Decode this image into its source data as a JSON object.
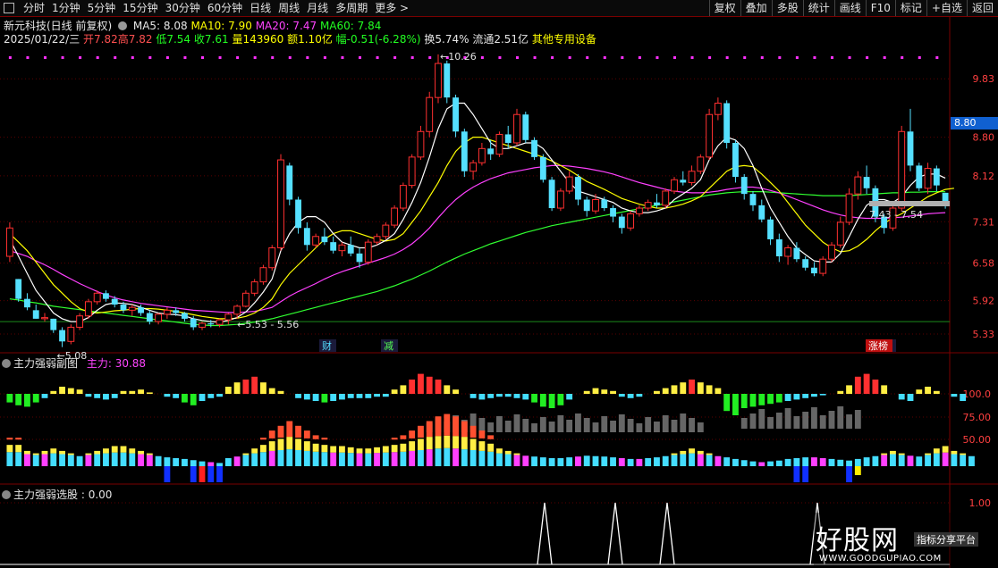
{
  "toolbar": {
    "period_tabs": [
      "分时",
      "1分钟",
      "5分钟",
      "15分钟",
      "30分钟",
      "60分钟",
      "日线",
      "周线",
      "月线",
      "多周期",
      "更多 >"
    ],
    "right_buttons": [
      "复权",
      "叠加",
      "多股",
      "统计",
      "画线",
      "F10",
      "标记",
      "+自选",
      "返回"
    ]
  },
  "stock": {
    "title": "新元科技(日线 前复权)",
    "ma5": "MA5: 8.08",
    "ma10": "MA10: 7.90",
    "ma20": "MA20: 7.47",
    "ma60": "MA60: 7.84",
    "date": "2025/01/22/三",
    "open": "开7.82",
    "high": "高7.82",
    "low": "低7.54",
    "close": "收7.61",
    "volume": "量143960",
    "amount": "额1.10亿",
    "change": "幅-0.51(-6.28%)",
    "turnover": "换5.74%",
    "float": "流通2.51亿",
    "sector": "其他专用设备"
  },
  "price_axis": [
    "9.83",
    "8.80",
    "8.12",
    "7.31",
    "6.58",
    "5.92",
    "5.33"
  ],
  "current_price": "8.80",
  "annotations": {
    "high": "10.26",
    "low": "5.08",
    "range_left": "5.53 - 5.56",
    "range_right": "7.43 - 7.54",
    "badge_cai": "财",
    "badge_jian": "减",
    "badge_zhangbang": "涨榜"
  },
  "indicator1": {
    "name": "主力强弱副图",
    "label": "主力: 30.88",
    "axis": [
      "100.0",
      "75.00",
      "50.00"
    ]
  },
  "indicator2": {
    "name": "主力强弱选股",
    "label": ": 0.00",
    "axis": [
      "1.00"
    ]
  },
  "watermark": {
    "logo": "好股网",
    "sub": "指标分享平台",
    "url": "WWW.GOODGUPIAO.COM"
  },
  "colors": {
    "up": "#ff3030",
    "down": "#55e0ff",
    "ma5": "#ffffff",
    "ma10": "#ffff00",
    "ma20": "#ff40ff",
    "ma60": "#30ff30",
    "background": "#000000"
  },
  "chart_data": {
    "type": "candlestick",
    "ohlc": [
      [
        6.7,
        7.3,
        6.6,
        7.2
      ],
      [
        6.3,
        6.3,
        5.9,
        5.95
      ],
      [
        5.95,
        6.05,
        5.75,
        5.8
      ],
      [
        5.75,
        5.85,
        5.6,
        5.6
      ],
      [
        5.6,
        5.7,
        5.55,
        5.62
      ],
      [
        5.6,
        5.6,
        5.35,
        5.4
      ],
      [
        5.4,
        5.45,
        5.1,
        5.2
      ],
      [
        5.2,
        5.5,
        5.15,
        5.45
      ],
      [
        5.45,
        5.7,
        5.4,
        5.65
      ],
      [
        5.65,
        5.95,
        5.6,
        5.9
      ],
      [
        5.9,
        6.1,
        5.85,
        6.05
      ],
      [
        6.05,
        6.1,
        5.9,
        5.95
      ],
      [
        5.95,
        6.0,
        5.8,
        5.85
      ],
      [
        5.85,
        5.9,
        5.7,
        5.75
      ],
      [
        5.75,
        5.85,
        5.65,
        5.8
      ],
      [
        5.8,
        5.85,
        5.65,
        5.7
      ],
      [
        5.7,
        5.75,
        5.5,
        5.55
      ],
      [
        5.55,
        5.7,
        5.5,
        5.68
      ],
      [
        5.68,
        5.8,
        5.6,
        5.75
      ],
      [
        5.75,
        5.8,
        5.65,
        5.7
      ],
      [
        5.7,
        5.72,
        5.55,
        5.6
      ],
      [
        5.6,
        5.65,
        5.4,
        5.45
      ],
      [
        5.45,
        5.55,
        5.4,
        5.52
      ],
      [
        5.52,
        5.58,
        5.45,
        5.5
      ],
      [
        5.5,
        5.6,
        5.45,
        5.58
      ],
      [
        5.58,
        5.7,
        5.5,
        5.68
      ],
      [
        5.68,
        5.85,
        5.6,
        5.82
      ],
      [
        5.82,
        6.1,
        5.8,
        6.05
      ],
      [
        6.05,
        6.3,
        6.0,
        6.25
      ],
      [
        6.25,
        6.55,
        6.2,
        6.5
      ],
      [
        6.5,
        6.9,
        6.45,
        6.85
      ],
      [
        6.85,
        8.5,
        6.8,
        8.4
      ],
      [
        8.3,
        8.35,
        7.6,
        7.7
      ],
      [
        7.7,
        7.75,
        7.1,
        7.2
      ],
      [
        7.2,
        7.3,
        6.8,
        6.9
      ],
      [
        6.9,
        7.1,
        6.85,
        7.05
      ],
      [
        7.05,
        7.2,
        6.9,
        6.95
      ],
      [
        6.95,
        7.05,
        6.75,
        6.8
      ],
      [
        6.8,
        6.95,
        6.7,
        6.9
      ],
      [
        6.9,
        7.05,
        6.7,
        6.75
      ],
      [
        6.75,
        6.85,
        6.5,
        6.6
      ],
      [
        6.6,
        7.0,
        6.55,
        6.95
      ],
      [
        6.95,
        7.1,
        6.9,
        7.05
      ],
      [
        7.05,
        7.3,
        7.0,
        7.25
      ],
      [
        7.25,
        7.6,
        7.2,
        7.55
      ],
      [
        7.55,
        8.0,
        7.5,
        7.95
      ],
      [
        7.95,
        8.5,
        7.9,
        8.45
      ],
      [
        8.45,
        9.0,
        8.4,
        8.9
      ],
      [
        8.9,
        9.6,
        8.8,
        9.5
      ],
      [
        9.5,
        10.26,
        9.4,
        10.1
      ],
      [
        10.1,
        10.15,
        9.4,
        9.5
      ],
      [
        9.5,
        9.55,
        8.8,
        8.9
      ],
      [
        8.9,
        8.95,
        8.1,
        8.2
      ],
      [
        8.2,
        8.4,
        8.05,
        8.35
      ],
      [
        8.35,
        8.7,
        8.3,
        8.6
      ],
      [
        8.6,
        8.75,
        8.4,
        8.5
      ],
      [
        8.5,
        8.9,
        8.45,
        8.85
      ],
      [
        8.85,
        9.0,
        8.6,
        8.7
      ],
      [
        8.7,
        9.3,
        8.65,
        9.2
      ],
      [
        9.2,
        9.25,
        8.7,
        8.75
      ],
      [
        8.75,
        8.8,
        8.4,
        8.45
      ],
      [
        8.45,
        8.5,
        8.0,
        8.05
      ],
      [
        8.05,
        8.1,
        7.5,
        7.55
      ],
      [
        7.55,
        7.9,
        7.5,
        7.85
      ],
      [
        7.85,
        8.2,
        7.8,
        8.1
      ],
      [
        8.1,
        8.15,
        7.6,
        7.7
      ],
      [
        7.7,
        7.75,
        7.4,
        7.5
      ],
      [
        7.5,
        7.8,
        7.45,
        7.7
      ],
      [
        7.7,
        7.75,
        7.5,
        7.55
      ],
      [
        7.55,
        7.6,
        7.3,
        7.4
      ],
      [
        7.4,
        7.45,
        7.1,
        7.2
      ],
      [
        7.2,
        7.5,
        7.15,
        7.45
      ],
      [
        7.45,
        7.6,
        7.4,
        7.55
      ],
      [
        7.55,
        7.7,
        7.5,
        7.65
      ],
      [
        7.65,
        7.8,
        7.55,
        7.6
      ],
      [
        7.6,
        7.9,
        7.55,
        7.85
      ],
      [
        7.85,
        8.1,
        7.8,
        8.05
      ],
      [
        8.05,
        8.2,
        7.95,
        8.0
      ],
      [
        8.0,
        8.3,
        7.95,
        8.2
      ],
      [
        8.2,
        8.5,
        8.15,
        8.45
      ],
      [
        8.45,
        9.3,
        8.4,
        9.2
      ],
      [
        9.2,
        9.5,
        9.1,
        9.4
      ],
      [
        9.4,
        9.45,
        8.6,
        8.7
      ],
      [
        8.7,
        8.75,
        8.0,
        8.1
      ],
      [
        8.1,
        8.15,
        7.7,
        7.8
      ],
      [
        7.8,
        7.85,
        7.5,
        7.6
      ],
      [
        7.6,
        7.7,
        7.3,
        7.35
      ],
      [
        7.35,
        7.4,
        6.9,
        7.0
      ],
      [
        7.0,
        7.1,
        6.6,
        6.7
      ],
      [
        6.7,
        6.9,
        6.55,
        6.85
      ],
      [
        6.85,
        6.95,
        6.6,
        6.65
      ],
      [
        6.65,
        6.7,
        6.45,
        6.5
      ],
      [
        6.5,
        6.6,
        6.35,
        6.4
      ],
      [
        6.4,
        6.7,
        6.35,
        6.65
      ],
      [
        6.65,
        6.95,
        6.6,
        6.9
      ],
      [
        6.9,
        7.4,
        6.85,
        7.3
      ],
      [
        7.3,
        7.9,
        7.25,
        7.8
      ],
      [
        7.8,
        8.2,
        7.7,
        8.1
      ],
      [
        8.1,
        8.3,
        7.8,
        7.9
      ],
      [
        7.9,
        7.95,
        7.3,
        7.4
      ],
      [
        7.4,
        7.45,
        7.1,
        7.2
      ],
      [
        7.2,
        7.6,
        7.15,
        7.55
      ],
      [
        7.55,
        9.0,
        7.5,
        8.9
      ],
      [
        8.9,
        9.3,
        8.2,
        8.3
      ],
      [
        8.3,
        8.35,
        7.85,
        7.9
      ],
      [
        7.9,
        8.35,
        7.8,
        8.25
      ],
      [
        8.25,
        8.3,
        7.85,
        7.95
      ],
      [
        7.82,
        7.82,
        7.54,
        7.61
      ]
    ],
    "ma5": [
      7.0,
      6.7,
      6.4,
      6.1,
      5.9,
      5.7,
      5.6,
      5.55,
      5.55,
      5.62,
      5.75,
      5.85,
      5.88,
      5.87,
      5.85,
      5.8,
      5.75,
      5.7,
      5.68,
      5.67,
      5.65,
      5.6,
      5.57,
      5.55,
      5.54,
      5.57,
      5.62,
      5.72,
      5.88,
      6.07,
      6.3,
      6.8,
      7.1,
      7.3,
      7.4,
      7.4,
      7.3,
      7.1,
      6.95,
      6.9,
      6.85,
      6.85,
      6.9,
      6.98,
      7.1,
      7.35,
      7.65,
      8.0,
      8.45,
      8.95,
      9.3,
      9.4,
      9.4,
      9.2,
      8.95,
      8.7,
      8.6,
      8.6,
      8.65,
      8.7,
      8.7,
      8.6,
      8.4,
      8.2,
      8.0,
      7.85,
      7.8,
      7.75,
      7.7,
      7.65,
      7.55,
      7.5,
      7.47,
      7.47,
      7.5,
      7.55,
      7.7,
      7.8,
      7.9,
      8.05,
      8.4,
      8.65,
      8.8,
      8.75,
      8.6,
      8.3,
      7.9,
      7.55,
      7.3,
      7.05,
      6.85,
      6.73,
      6.62,
      6.6,
      6.6,
      6.75,
      7.05,
      7.35,
      7.6,
      7.7,
      7.7,
      7.65,
      7.75,
      7.95,
      8.1,
      8.15,
      8.15,
      8.08
    ],
    "ma10": [
      7.1,
      6.95,
      6.8,
      6.6,
      6.4,
      6.2,
      6.05,
      5.9,
      5.78,
      5.72,
      5.7,
      5.72,
      5.74,
      5.75,
      5.77,
      5.78,
      5.78,
      5.77,
      5.75,
      5.73,
      5.7,
      5.67,
      5.64,
      5.62,
      5.6,
      5.6,
      5.61,
      5.64,
      5.7,
      5.8,
      5.95,
      6.2,
      6.4,
      6.55,
      6.7,
      6.85,
      7.0,
      7.1,
      7.15,
      7.15,
      7.1,
      7.05,
      7.0,
      6.97,
      7.0,
      7.1,
      7.3,
      7.5,
      7.75,
      8.0,
      8.3,
      8.55,
      8.7,
      8.8,
      8.8,
      8.75,
      8.7,
      8.65,
      8.6,
      8.55,
      8.5,
      8.45,
      8.38,
      8.3,
      8.22,
      8.12,
      8.02,
      7.95,
      7.88,
      7.8,
      7.72,
      7.67,
      7.62,
      7.58,
      7.55,
      7.55,
      7.58,
      7.62,
      7.68,
      7.75,
      7.9,
      8.05,
      8.2,
      8.28,
      8.3,
      8.28,
      8.15,
      8.0,
      7.85,
      7.65,
      7.45,
      7.25,
      7.1,
      6.95,
      6.85,
      6.78,
      6.8,
      6.88,
      7.0,
      7.15,
      7.28,
      7.38,
      7.45,
      7.55,
      7.65,
      7.75,
      7.82,
      7.88,
      7.9
    ],
    "ma20": [
      6.8,
      6.75,
      6.7,
      6.62,
      6.55,
      6.47,
      6.38,
      6.3,
      6.22,
      6.15,
      6.08,
      6.02,
      5.97,
      5.93,
      5.9,
      5.87,
      5.85,
      5.83,
      5.81,
      5.79,
      5.77,
      5.75,
      5.74,
      5.73,
      5.72,
      5.71,
      5.71,
      5.72,
      5.73,
      5.76,
      5.8,
      5.9,
      6.0,
      6.08,
      6.15,
      6.22,
      6.3,
      6.37,
      6.43,
      6.48,
      6.53,
      6.58,
      6.63,
      6.68,
      6.74,
      6.82,
      6.92,
      7.05,
      7.2,
      7.38,
      7.55,
      7.7,
      7.82,
      7.92,
      8.0,
      8.07,
      8.12,
      8.17,
      8.2,
      8.23,
      8.26,
      8.28,
      8.3,
      8.3,
      8.29,
      8.27,
      8.25,
      8.22,
      8.19,
      8.15,
      8.1,
      8.05,
      8.0,
      7.96,
      7.92,
      7.88,
      7.85,
      7.83,
      7.82,
      7.82,
      7.83,
      7.85,
      7.88,
      7.9,
      7.92,
      7.92,
      7.9,
      7.86,
      7.82,
      7.76,
      7.7,
      7.64,
      7.58,
      7.52,
      7.47,
      7.43,
      7.4,
      7.38,
      7.37,
      7.37,
      7.37,
      7.38,
      7.39,
      7.41,
      7.43,
      7.45,
      7.46,
      7.47
    ],
    "ma60": [
      5.95,
      5.93,
      5.9,
      5.88,
      5.85,
      5.82,
      5.8,
      5.78,
      5.76,
      5.74,
      5.72,
      5.7,
      5.68,
      5.66,
      5.64,
      5.62,
      5.6,
      5.58,
      5.56,
      5.54,
      5.52,
      5.5,
      5.49,
      5.48,
      5.48,
      5.49,
      5.5,
      5.52,
      5.54,
      5.57,
      5.6,
      5.64,
      5.68,
      5.72,
      5.76,
      5.8,
      5.84,
      5.88,
      5.92,
      5.96,
      6.0,
      6.04,
      6.08,
      6.13,
      6.18,
      6.24,
      6.3,
      6.37,
      6.44,
      6.52,
      6.6,
      6.67,
      6.74,
      6.8,
      6.86,
      6.92,
      6.97,
      7.02,
      7.07,
      7.12,
      7.16,
      7.2,
      7.24,
      7.27,
      7.3,
      7.33,
      7.36,
      7.39,
      7.42,
      7.45,
      7.48,
      7.51,
      7.54,
      7.57,
      7.6,
      7.63,
      7.66,
      7.69,
      7.72,
      7.75,
      7.78,
      7.8,
      7.82,
      7.83,
      7.84,
      7.84,
      7.84,
      7.83,
      7.82,
      7.81,
      7.8,
      7.79,
      7.78,
      7.77,
      7.77,
      7.77,
      7.77,
      7.78,
      7.79,
      7.8,
      7.81,
      7.82,
      7.82,
      7.83,
      7.83,
      7.84,
      7.84,
      7.84
    ],
    "ylim": [
      5.0,
      10.4
    ],
    "ind1_top": [
      -6,
      -8,
      -9,
      -6,
      -3,
      2,
      5,
      4,
      3,
      -2,
      -3,
      -4,
      -3,
      2,
      2,
      3,
      1,
      0,
      -2,
      -3,
      -6,
      -8,
      -5,
      -3,
      -2,
      5,
      8,
      10,
      12,
      8,
      4,
      2,
      0,
      -3,
      -4,
      -5,
      -6,
      -5,
      -4,
      -3,
      -3,
      -3,
      -2,
      -2,
      3,
      6,
      10,
      14,
      12,
      10,
      6,
      3,
      0,
      -3,
      -4,
      -3,
      -2,
      -2,
      -3,
      -4,
      -6,
      -9,
      -10,
      -8,
      -4,
      0,
      2,
      4,
      3,
      2,
      -2,
      -3,
      -2,
      0,
      2,
      4,
      6,
      8,
      10,
      8,
      6,
      4,
      -12,
      -15,
      -10,
      -9,
      -8,
      -7,
      -6,
      -5,
      -4,
      -3,
      -2,
      -1,
      0,
      2,
      6,
      12,
      14,
      10,
      6,
      0,
      -4,
      -5,
      3,
      5,
      2,
      0,
      -2,
      -5
    ],
    "ind1_gray": [
      0,
      0,
      0,
      0,
      0,
      0,
      0,
      0,
      0,
      0,
      0,
      0,
      0,
      0,
      0,
      0,
      0,
      0,
      0,
      0,
      0,
      0,
      0,
      0,
      0,
      0,
      0,
      0,
      0,
      0,
      0,
      0,
      0,
      0,
      0,
      0,
      0,
      0,
      0,
      0,
      0,
      0,
      0,
      0,
      0,
      0,
      0,
      0,
      0,
      0,
      0,
      0,
      0,
      0,
      0,
      0,
      0,
      0,
      0,
      0,
      0,
      0,
      0,
      0,
      0,
      0,
      0,
      0,
      0,
      0,
      0,
      0,
      0,
      0,
      0,
      0,
      0,
      0,
      0,
      0,
      0,
      0,
      0,
      0,
      0,
      0,
      0,
      0,
      0,
      0,
      0,
      0,
      0,
      0,
      0,
      0,
      0,
      0,
      0,
      0,
      0,
      0,
      0,
      0,
      0,
      0,
      0,
      0
    ],
    "ind1_bottom": [
      35,
      35,
      30,
      28,
      30,
      32,
      30,
      28,
      25,
      28,
      30,
      32,
      34,
      34,
      32,
      30,
      28,
      25,
      22,
      20,
      18,
      15,
      12,
      10,
      8,
      20,
      24,
      28,
      32,
      35,
      38,
      40,
      42,
      40,
      38,
      36,
      35,
      34,
      34,
      33,
      32,
      32,
      33,
      34,
      35,
      36,
      38,
      40,
      42,
      44,
      45,
      44,
      42,
      40,
      38,
      36,
      32,
      30,
      28,
      26,
      24,
      22,
      20,
      20,
      22,
      24,
      26,
      25,
      24,
      22,
      20,
      18,
      18,
      20,
      22,
      25,
      28,
      30,
      32,
      30,
      28,
      25,
      22,
      18,
      15,
      12,
      10,
      12,
      14,
      18,
      20,
      22,
      22,
      20,
      18,
      16,
      14,
      18,
      22,
      25,
      28,
      30,
      28,
      26,
      24,
      28,
      32,
      34,
      30,
      28,
      25
    ],
    "signal_peaks": [
      82,
      91,
      99,
      122
    ]
  }
}
